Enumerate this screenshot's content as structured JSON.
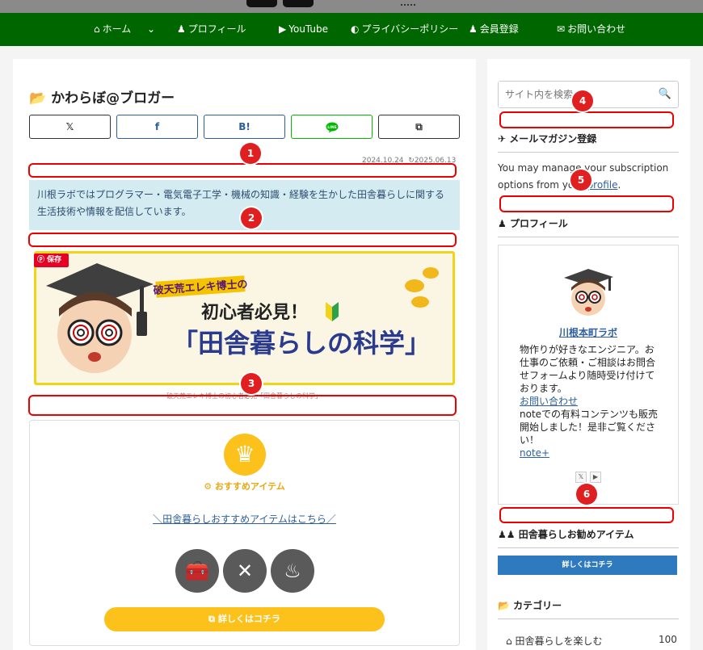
{
  "nav": {
    "items": [
      {
        "icon": "home-icon",
        "glyph": "⌂",
        "label": "ホーム"
      },
      {
        "icon": "chevron-down-icon",
        "glyph": "⌄",
        "label": ""
      },
      {
        "icon": "user-icon",
        "glyph": "👤",
        "label": "プロフィール"
      },
      {
        "icon": "youtube-icon",
        "glyph": "▶",
        "label": "YouTube"
      },
      {
        "icon": "shield-icon",
        "glyph": "◐",
        "label": "プライバシーポリシー"
      },
      {
        "icon": "user-plus-icon",
        "glyph": "👤",
        "label": "会員登録"
      },
      {
        "icon": "mail-icon",
        "glyph": "✉",
        "label": "お問い合わせ"
      }
    ]
  },
  "main": {
    "title_icon": "📂",
    "title": "かわらぼ@ブロガー",
    "share": [
      {
        "label": "𝕏",
        "color": "#333333"
      },
      {
        "label": "f",
        "color": "#2d5f9e"
      },
      {
        "label": "B!",
        "color": "#2d5f9e"
      },
      {
        "label": "LINE",
        "color": "#00b900"
      },
      {
        "label": "⧉",
        "color": "#333333"
      }
    ],
    "date_posted": "2024.10.24",
    "date_updated": "2025.06.13",
    "intro": "川根ラボではプログラマー・電気電子工学・機械の知識・経験を生かした田舎暮らしに関する生活技術や情報を配信しています。",
    "banner": {
      "pin_label": "保存",
      "tag": "破天荒エレキ博士の",
      "headline": "初心者必見！",
      "title": "「田舎暮らしの科学」"
    },
    "caption": "破天荒エレキ博士の初心者必見「田舎暮らしの科学」",
    "recommend": {
      "label": "おすすめアイテム",
      "link": "＼田舎暮らしおすすめアイテムはこちら／",
      "cta": "詳しくはコチラ"
    }
  },
  "annotations": [
    "1",
    "2",
    "3",
    "4",
    "5",
    "6"
  ],
  "sidebar": {
    "search_placeholder": "サイト内を検索",
    "mail_heading": "メールマガジン登録",
    "mail_text_pre": "You may manage your subscription options from your ",
    "mail_link": "profile",
    "mail_text_post": ".",
    "profile_heading": "プロフィール",
    "profile_name": "川根本町ラボ",
    "profile_desc1": "物作りが好きなエンジニア。お仕事のご依頼・ご相談はお問合せフォームより随時受け付けております。",
    "profile_link1": "お問い合わせ",
    "profile_desc2": "noteでの有料コンテンツも販売開始しました！是非ご覧ください！",
    "profile_link2": "note+",
    "items_heading": "田舎暮らしお勧めアイテム",
    "items_button": "詳しくはコチラ",
    "category_heading": "カテゴリー",
    "category_item": "田舎暮らしを楽しむ",
    "category_count": "100"
  },
  "colors": {
    "nav": "#006600",
    "annotation": "#e00000",
    "accent": "#fcc11b"
  }
}
